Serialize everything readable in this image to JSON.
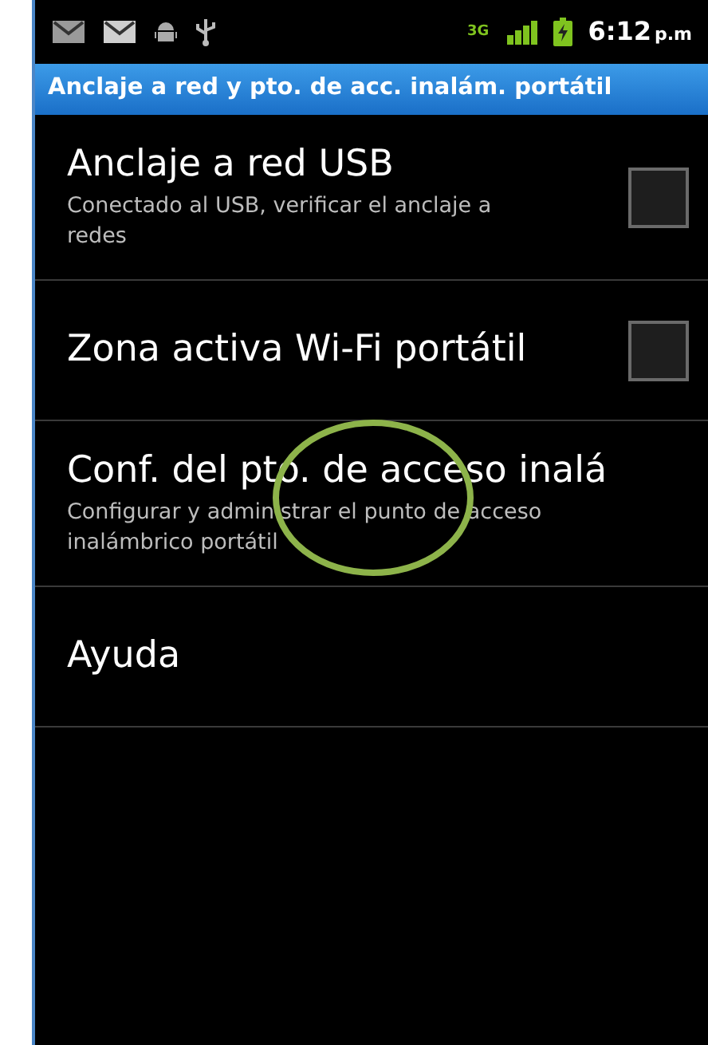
{
  "status_bar": {
    "network": "3G",
    "time": "6:12",
    "time_suffix": "p.m"
  },
  "title_bar": {
    "title": "Anclaje a red y pto. de acc. inalám. portátil"
  },
  "settings": [
    {
      "kind": "checkbox",
      "title": "Anclaje a red USB",
      "summary": "Conectado al USB, verificar el anclaje a redes",
      "checked": false
    },
    {
      "kind": "checkbox",
      "title": "Zona activa Wi-Fi portátil",
      "checked": false
    },
    {
      "kind": "link",
      "title": "Conf. del pto. de acceso inalá",
      "summary": "Configurar y administrar el punto de acceso inalámbrico portátil"
    },
    {
      "kind": "link",
      "title": "Ayuda"
    }
  ]
}
